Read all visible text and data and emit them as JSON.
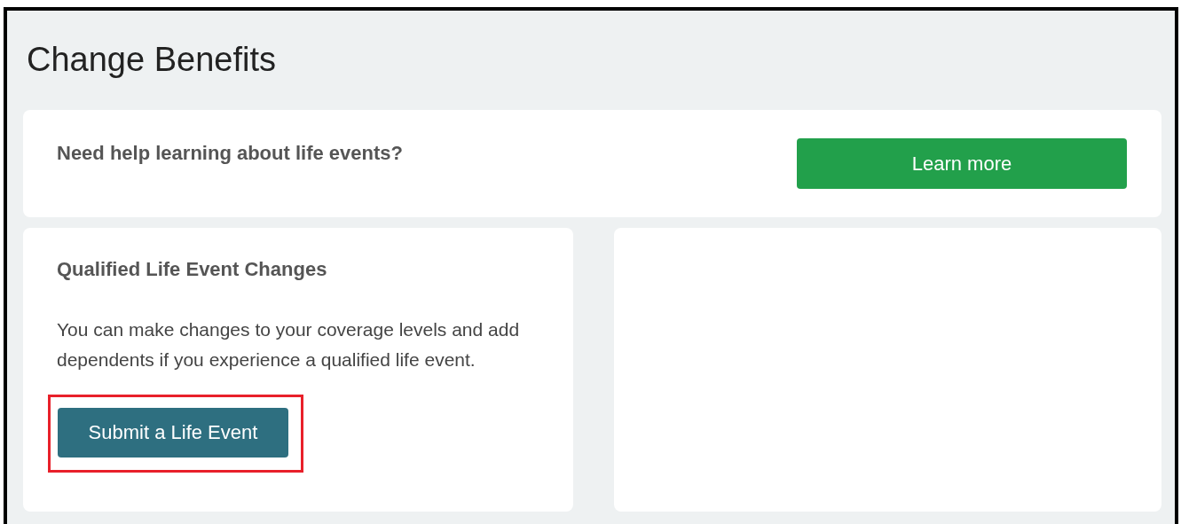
{
  "page": {
    "title": "Change Benefits"
  },
  "help_card": {
    "text": "Need help learning about life events?",
    "button": "Learn more"
  },
  "life_event_card": {
    "heading": "Qualified Life Event Changes",
    "body": "You can make changes to your coverage levels and add dependents if you experience a qualified life event.",
    "button": {
      "label": "Submit a Life Event",
      "highlighted": true
    }
  }
}
